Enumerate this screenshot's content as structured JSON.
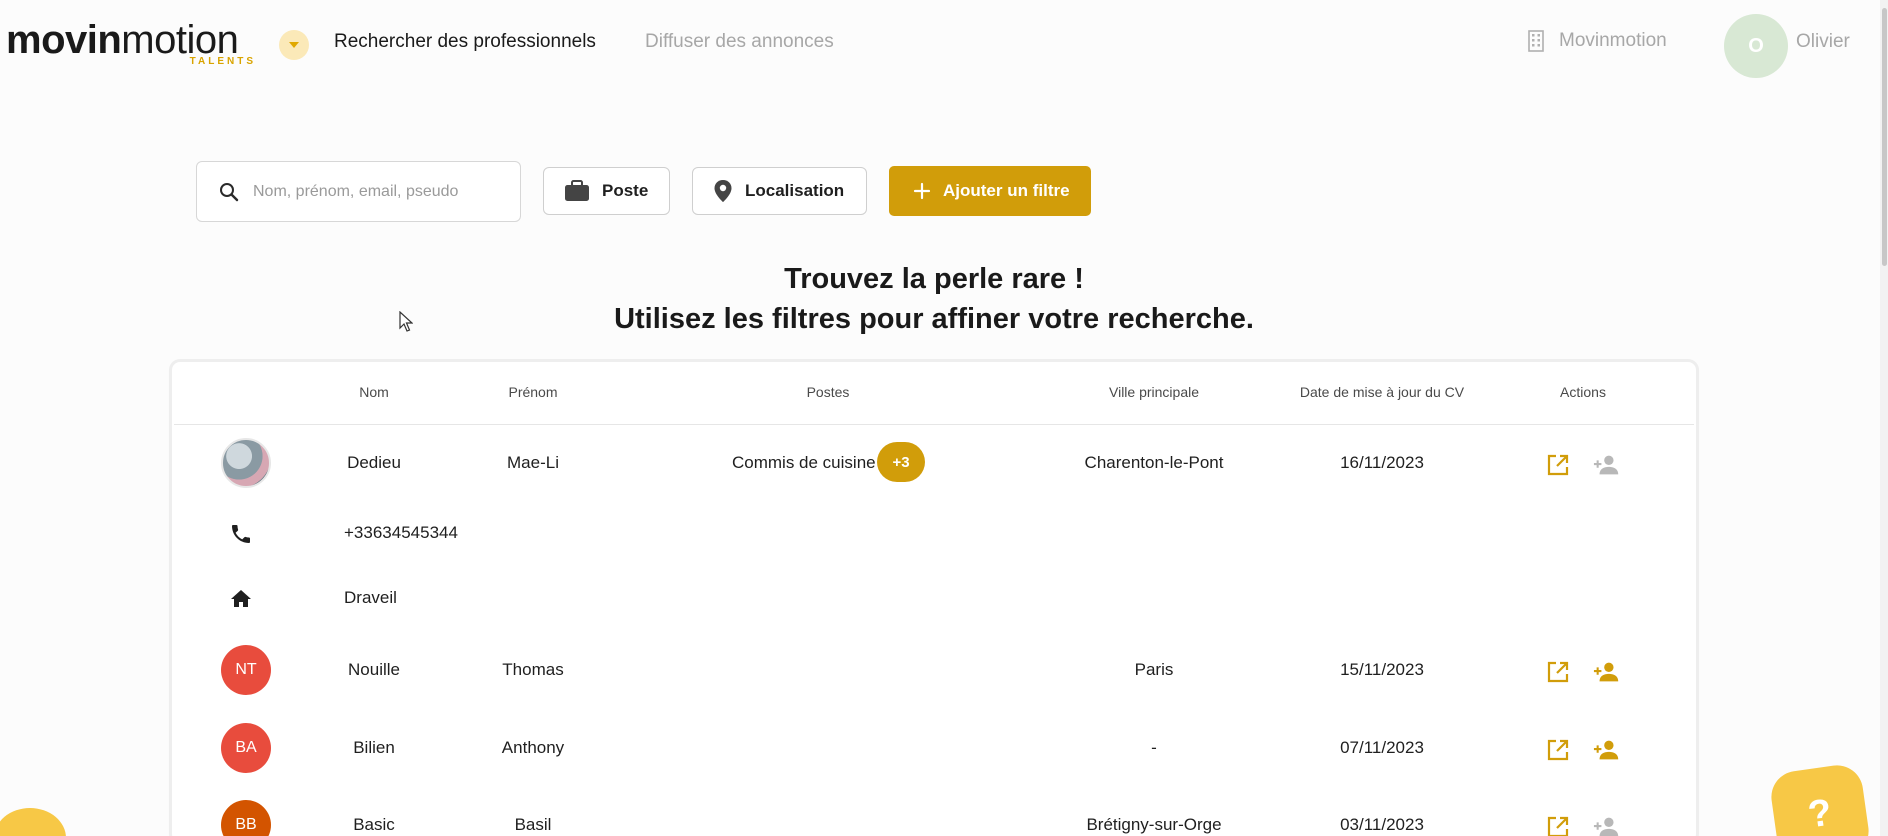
{
  "header": {
    "brand_word_bold": "movin",
    "brand_word_light": "motion",
    "brand_sub": "TALENTS",
    "nav_active": "Rechercher des professionnels",
    "nav_inactive": "Diffuser des annonces",
    "org_name": "Movinmotion",
    "user_initial": "O",
    "user_name": "Olivier"
  },
  "search": {
    "placeholder": "Nom, prénom, email, pseudo",
    "chip_poste": "Poste",
    "chip_localisation": "Localisation",
    "add_filter": "Ajouter un filtre"
  },
  "headline": {
    "line1": "Trouvez la perle rare !",
    "line2": "Utilisez les filtres pour affiner votre recherche."
  },
  "table": {
    "columns": [
      "Nom",
      "Prénom",
      "Postes",
      "Ville principale",
      "Date de mise à jour du CV",
      "Actions"
    ],
    "rows": [
      {
        "nom": "Dedieu",
        "prenom": "Mae-Li",
        "poste": "Commis de cuisine",
        "more": "+3",
        "ville": "Charenton-le-Pont",
        "date": "16/11/2023",
        "phone": "+33634545344",
        "home": "Draveil"
      },
      {
        "initials": "NT",
        "nom": "Nouille",
        "prenom": "Thomas",
        "ville": "Paris",
        "date": "15/11/2023"
      },
      {
        "initials": "BA",
        "nom": "Bilien",
        "prenom": "Anthony",
        "ville": "-",
        "date": "07/11/2023"
      },
      {
        "initials": "BB",
        "nom": "Basic",
        "prenom": "Basil",
        "ville": "Brétigny-sur-Orge",
        "date": "03/11/2023"
      }
    ]
  },
  "help_label": "?",
  "colors": {
    "accent": "#d19d0a",
    "avatar_red": "#e84c3d",
    "avatar_orange": "#d35400"
  }
}
